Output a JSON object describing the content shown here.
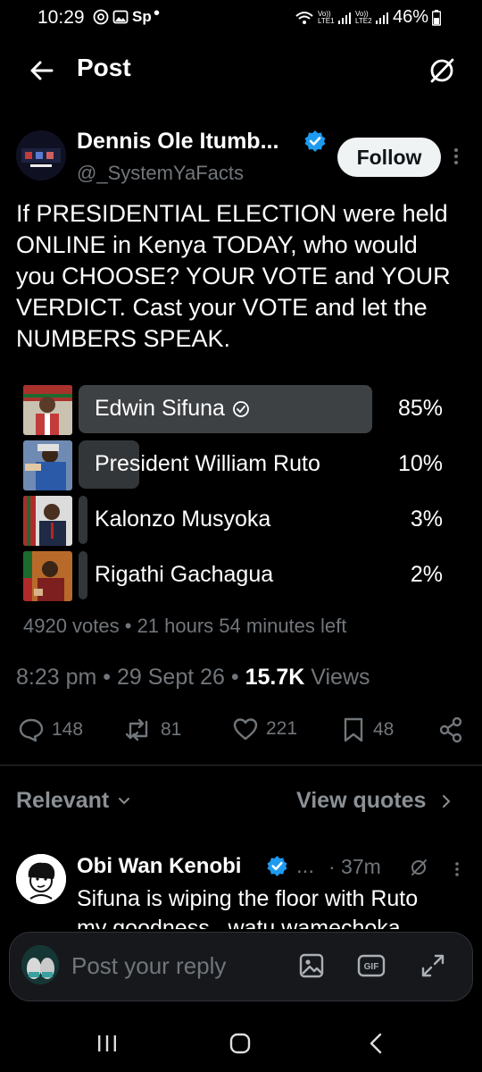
{
  "status_bar": {
    "time": "10:29",
    "carrier_icon_text": "Sp",
    "network_1": "Vo)) LTE1",
    "network_2": "Vo)) LTE2",
    "battery": "46%"
  },
  "header": {
    "title": "Post",
    "back_icon": "arrow-left-icon",
    "grok_icon": "grok-icon"
  },
  "author": {
    "name": "Dennis Ole Itumb...",
    "handle": "@_SystemYaFacts",
    "verified": true,
    "follow_label": "Follow"
  },
  "tweet": {
    "text": "If PRESIDENTIAL ELECTION were held ONLINE in Kenya TODAY, who would you CHOOSE? YOUR VOTE and YOUR VERDICT. Cast your VOTE and let the NUMBERS SPEAK."
  },
  "poll": {
    "options": [
      {
        "label": "Edwin Sifuna",
        "percent": "85%",
        "value": 85,
        "selected": true
      },
      {
        "label": "President William Ruto",
        "percent": "10%",
        "value": 10,
        "selected": false
      },
      {
        "label": "Kalonzo Musyoka",
        "percent": "3%",
        "value": 3,
        "selected": false
      },
      {
        "label": "Rigathi Gachagua",
        "percent": "2%",
        "value": 2,
        "selected": false
      }
    ],
    "meta": "4920 votes • 21 hours 54 minutes left"
  },
  "post_meta": {
    "time": "8:23 pm",
    "date": "29 Sept 26",
    "views_count": "15.7K",
    "views_label": "Views"
  },
  "actions": {
    "replies": "148",
    "reposts": "81",
    "likes": "221",
    "bookmarks": "48"
  },
  "sort": {
    "relevant_label": "Relevant",
    "view_quotes_label": "View quotes"
  },
  "reply": {
    "name": "Obi Wan Kenobi",
    "verified": true,
    "ellipsis": "...",
    "time": "· 37m",
    "text": "Sifuna is wiping the floor with Ruto",
    "text_line2": "my goodness.. watu wamechoka"
  },
  "composer": {
    "placeholder": "Post your reply",
    "gif_label": "GIF"
  },
  "colors": {
    "background": "#000000",
    "verified": "#1d9bf0",
    "muted": "#71767b",
    "poll_bar": "#333639"
  }
}
